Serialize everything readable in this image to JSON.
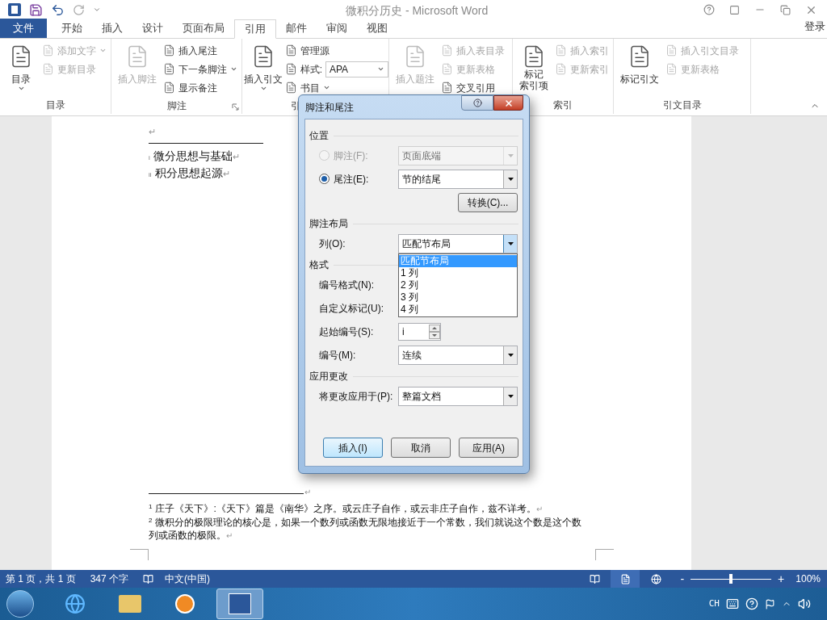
{
  "title_bar": {
    "title": "微积分历史 - Microsoft Word"
  },
  "ribbon_tabs": [
    {
      "label": "文件",
      "kind": "file",
      "selected": false
    },
    {
      "label": "开始",
      "kind": "tab",
      "selected": false
    },
    {
      "label": "插入",
      "kind": "tab",
      "selected": false
    },
    {
      "label": "设计",
      "kind": "tab",
      "selected": false
    },
    {
      "label": "页面布局",
      "kind": "tab",
      "selected": false
    },
    {
      "label": "引用",
      "kind": "tab",
      "selected": true
    },
    {
      "label": "邮件",
      "kind": "tab",
      "selected": false
    },
    {
      "label": "审阅",
      "kind": "tab",
      "selected": false
    },
    {
      "label": "视图",
      "kind": "tab",
      "selected": false
    }
  ],
  "sign_in": "登录",
  "ribbon_groups": [
    {
      "label": "目录",
      "commands": [
        {
          "kind": "large",
          "label": "目录",
          "disabled": false,
          "dropdown": true
        },
        {
          "kind": "small",
          "label": "添加文字",
          "disabled": true,
          "dropdown": true
        },
        {
          "kind": "small",
          "label": "更新目录",
          "disabled": true,
          "dropdown": false
        }
      ]
    },
    {
      "label": "脚注",
      "launcher": true,
      "commands": [
        {
          "kind": "large",
          "label": "插入脚注",
          "disabled": true,
          "dropdown": false
        },
        {
          "kind": "small",
          "label": "插入尾注",
          "disabled": false,
          "dropdown": false
        },
        {
          "kind": "small",
          "label": "下一条脚注",
          "disabled": false,
          "dropdown": true
        },
        {
          "kind": "small",
          "label": "显示备注",
          "disabled": false,
          "dropdown": false
        }
      ]
    },
    {
      "label": "引",
      "commands": [
        {
          "kind": "large",
          "label": "插入引文",
          "disabled": false,
          "dropdown": true
        },
        {
          "kind": "small",
          "label": "管理源",
          "disabled": false,
          "dropdown": false
        },
        {
          "kind": "combo",
          "label": "样式:",
          "value": "APA",
          "disabled": false,
          "dropdown": true
        },
        {
          "kind": "small",
          "label": "书目",
          "disabled": false,
          "dropdown": true
        }
      ]
    },
    {
      "commands": [
        {
          "kind": "large",
          "label": "插入题注",
          "disabled": true,
          "dropdown": false
        },
        {
          "kind": "small",
          "label": "插入表目录",
          "disabled": true,
          "dropdown": false
        },
        {
          "kind": "small",
          "label": "更新表格",
          "disabled": true,
          "dropdown": false
        },
        {
          "kind": "small",
          "label": "交叉引用",
          "disabled": false,
          "dropdown": false
        }
      ]
    },
    {
      "label": "索引",
      "commands": [
        {
          "kind": "large",
          "lines": [
            "标记",
            "索引项"
          ],
          "disabled": false,
          "dropdown": false
        },
        {
          "kind": "small",
          "label": "插入索引",
          "disabled": true,
          "dropdown": false
        },
        {
          "kind": "small",
          "label": "更新索引",
          "disabled": true,
          "dropdown": false
        }
      ]
    },
    {
      "label": "引文目录",
      "commands": [
        {
          "kind": "large",
          "label": "标记引文",
          "disabled": false,
          "dropdown": false
        },
        {
          "kind": "small",
          "label": "插入引文目录",
          "disabled": true,
          "dropdown": false
        },
        {
          "kind": "small",
          "label": "更新表格",
          "disabled": true,
          "dropdown": false
        }
      ]
    }
  ],
  "document": {
    "top_mark": "↵",
    "endnote_refs": [
      {
        "mark": "i",
        "text": "微分思想与基础",
        "end": "↵"
      },
      {
        "mark": "ii",
        "text": "积分思想起源",
        "end": "↵"
      }
    ],
    "separator_mark": "↵",
    "footnotes": [
      {
        "mark": "1",
        "text": "庄子《天下》:《天下》篇是《南华》之序。或云庄子自作，或云非庄子自作，兹不详考。",
        "end": "↵"
      },
      {
        "mark": "2",
        "text": "微积分的极限理论的核心是，如果一个数列或函数无限地接近于一个常数，我们就说这个数是这个数列或函数的极限。",
        "end": "↵"
      }
    ]
  },
  "dialog": {
    "title": "脚注和尾注",
    "sections": [
      {
        "heading": "位置",
        "rows": [
          {
            "kind": "radio-combo",
            "label": "脚注(F):",
            "selected": false,
            "disabled": true,
            "value": "页面底端"
          },
          {
            "kind": "radio-combo",
            "label": "尾注(E):",
            "selected": true,
            "disabled": false,
            "value": "节的结尾"
          },
          {
            "kind": "button",
            "label": "转换(C)..."
          }
        ]
      },
      {
        "heading": "脚注布局",
        "rows": [
          {
            "kind": "combo",
            "label": "列(O):",
            "value": "匹配节布局",
            "expanded": true,
            "options": [
              {
                "label": "匹配节布局",
                "selected": true
              },
              {
                "label": "1 列",
                "selected": false
              },
              {
                "label": "2 列",
                "selected": false
              },
              {
                "label": "3 列",
                "selected": false
              },
              {
                "label": "4 列",
                "selected": false
              }
            ]
          }
        ]
      },
      {
        "heading": "格式",
        "rows": [
          {
            "kind": "combo",
            "label": "编号格式(N):",
            "expanded": false
          },
          {
            "kind": "text-button",
            "label": "自定义标记(U):"
          },
          {
            "kind": "spinner",
            "label": "起始编号(S):",
            "value": "i"
          },
          {
            "kind": "combo",
            "label": "编号(M):",
            "value": "连续",
            "expanded": false
          }
        ]
      },
      {
        "heading": "应用更改",
        "rows": [
          {
            "kind": "combo",
            "label": "将更改应用于(P):",
            "value": "整篇文档",
            "expanded": false
          }
        ]
      }
    ],
    "buttons": [
      {
        "label": "插入(I)",
        "default": true
      },
      {
        "label": "取消",
        "default": false
      },
      {
        "label": "应用(A)",
        "default": false
      }
    ]
  },
  "status_bar": {
    "page": "第 1 页，共 1 页",
    "words": "347 个字",
    "language": "中文(中国)",
    "views": [
      {
        "selected": false
      },
      {
        "selected": true
      },
      {
        "selected": false
      }
    ],
    "zoom": {
      "level": 0.5,
      "minus": "-",
      "plus": "+",
      "reading": "100%"
    }
  },
  "taskbar": {
    "apps": [
      {
        "selected": false
      },
      {
        "selected": false
      },
      {
        "selected": false
      },
      {
        "selected": true
      }
    ],
    "input_language": "CH"
  }
}
